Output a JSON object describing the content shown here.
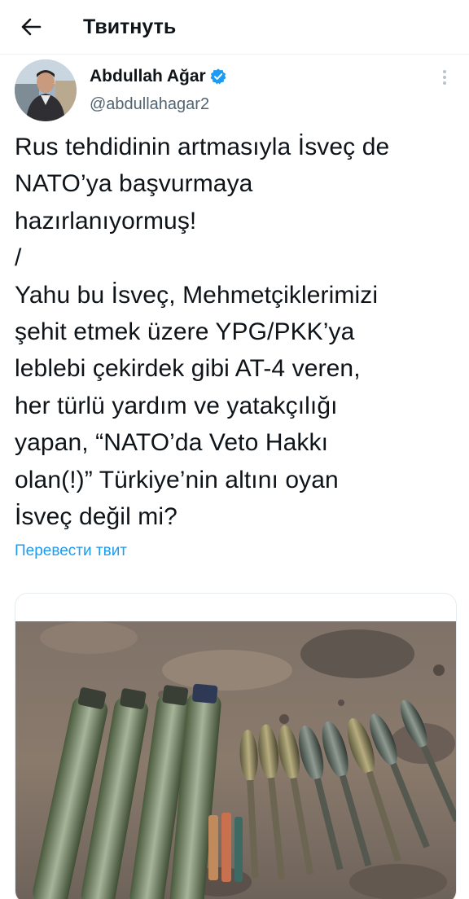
{
  "header": {
    "title": "Твитнуть",
    "back_icon": "arrow-left-icon"
  },
  "tweet": {
    "author": {
      "name": "Abdullah Ağar",
      "handle": "@abdullahagar2",
      "verified": true,
      "verified_color": "#1d9bf0"
    },
    "text": "Rus tehdidinin artmasıyla İsveç de\nNATO’ya başvurmaya\nhazırlanıyormuş!\n/\nYahu bu İsveç, Mehmetçiklerimizi\nşehit etmek üzere YPG/PKK’ya\nleblebi çekirdek gibi AT-4 veren,\nher türlü yardım ve yatakçılığı\nyapan, “NATO’da Veto Hakkı\nolan(!)” Türkiye’nin altını oyan\nİsveç değil mi?",
    "translate_label": "Перевести твит",
    "media": {
      "type": "photo",
      "icon": "photo"
    }
  },
  "colors": {
    "link": "#1d9bf0",
    "secondary_text": "#536471",
    "primary_text": "#0f1419"
  }
}
